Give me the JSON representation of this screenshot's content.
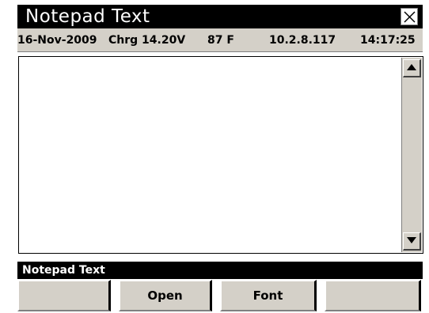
{
  "window": {
    "title": "Notepad Text",
    "close_icon": "close-icon"
  },
  "status": {
    "date": "16-Nov-2009",
    "charge": "Chrg 14.20V",
    "temperature": "87 F",
    "ip": "10.2.8.117",
    "time": "14:17:25"
  },
  "editor": {
    "text": "",
    "scroll_up_icon": "arrow-up-icon",
    "scroll_down_icon": "arrow-down-icon"
  },
  "label_bar": {
    "text": "Notepad Text"
  },
  "softkeys": [
    {
      "label": ""
    },
    {
      "label": "Open"
    },
    {
      "label": "Font"
    },
    {
      "label": ""
    }
  ],
  "colors": {
    "titlebar_bg": "#000000",
    "panel_bg": "#d4d0c8",
    "text_bg": "#ffffff"
  }
}
